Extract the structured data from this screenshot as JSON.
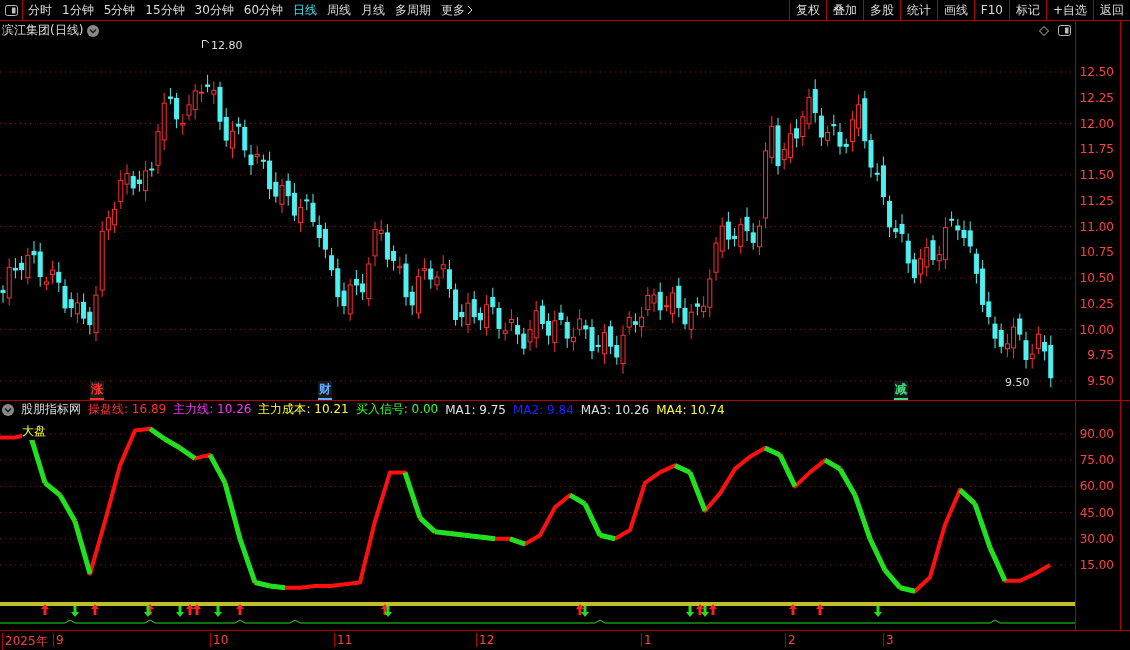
{
  "toolbar": {
    "periods": [
      {
        "label": "分时",
        "selected": false
      },
      {
        "label": "1分钟",
        "selected": false
      },
      {
        "label": "5分钟",
        "selected": false
      },
      {
        "label": "15分钟",
        "selected": false
      },
      {
        "label": "30分钟",
        "selected": false
      },
      {
        "label": "60分钟",
        "selected": false
      },
      {
        "label": "日线",
        "selected": true
      },
      {
        "label": "周线",
        "selected": false
      },
      {
        "label": "月线",
        "selected": false
      },
      {
        "label": "多周期",
        "selected": false
      },
      {
        "label": "更多",
        "selected": false
      }
    ],
    "actions": [
      "复权",
      "叠加",
      "多股",
      "统计",
      "画线",
      "F10",
      "标记",
      "+自选",
      "返回"
    ]
  },
  "price_chart": {
    "title": "滨江集团(日线)",
    "high_label": "12.80",
    "low_label": "9.50",
    "y_axis": [
      "12.50",
      "12.25",
      "12.00",
      "11.75",
      "11.50",
      "11.25",
      "11.00",
      "10.75",
      "10.50",
      "10.25",
      "10.00",
      "9.75",
      "9.50"
    ],
    "event_markers": [
      {
        "label": "涨",
        "color": "#ff3030"
      },
      {
        "label": "财",
        "color": "#60b0ff"
      },
      {
        "label": "减",
        "color": "#40e080"
      }
    ]
  },
  "indicator": {
    "name": "股朋指标网",
    "legend": [
      {
        "label": "操盘线: 16.89",
        "color": "#ff3030"
      },
      {
        "label": "主力线: 10.26",
        "color": "#ff30ff"
      },
      {
        "label": "主力成本: 10.21",
        "color": "#ffff30"
      },
      {
        "label": "买入信号: 0.00",
        "color": "#30ff30"
      },
      {
        "label": "MA1: 9.75",
        "color": "#e0e0e0"
      },
      {
        "label": "MA2: 9.84",
        "color": "#2020ff"
      },
      {
        "label": "MA3: 10.26",
        "color": "#e0e0e0"
      },
      {
        "label": "MA4: 10.74",
        "color": "#ffff30"
      }
    ],
    "tag": "大盘",
    "y_axis": [
      "90.00",
      "75.00",
      "60.00",
      "45.00",
      "30.00",
      "15.00"
    ]
  },
  "time_axis": [
    "2025年",
    "9",
    "10",
    "11",
    "12",
    "1",
    "2",
    "3"
  ]
}
